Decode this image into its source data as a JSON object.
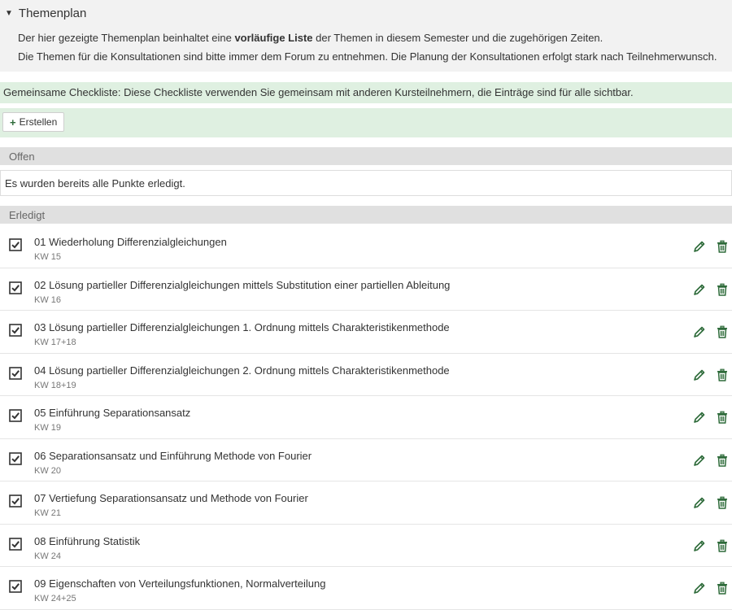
{
  "header": {
    "title": "Themenplan",
    "desc1_prefix": "Der hier gezeigte Themenplan beinhaltet eine ",
    "desc1_bold": "vorläufige Liste",
    "desc1_suffix": " der Themen in diesem Semester und die zugehörigen Zeiten.",
    "desc2": "Die Themen für die Konsultationen sind bitte immer dem Forum zu entnehmen. Die Planung der Konsultationen erfolgt stark nach Teilnehmerwunsch."
  },
  "checklist": {
    "shared_note": "Gemeinsame Checkliste: Diese Checkliste verwenden Sie gemeinsam mit anderen Kursteilnehmern, die Einträge sind für alle sichtbar.",
    "create_label": "Erstellen",
    "open_label": "Offen",
    "open_empty": "Es wurden bereits alle Punkte erledigt.",
    "done_label": "Erledigt"
  },
  "items": [
    {
      "title": "01 Wiederholung Differenzialgleichungen",
      "week": "KW 15"
    },
    {
      "title": "02 Lösung partieller Differenzialgleichungen mittels Substitution einer partiellen Ableitung",
      "week": "KW 16"
    },
    {
      "title": "03 Lösung partieller Differenzialgleichungen 1. Ordnung mittels Charakteristikenmethode",
      "week": "KW 17+18"
    },
    {
      "title": "04 Lösung partieller Differenzialgleichungen 2. Ordnung mittels Charakteristikenmethode",
      "week": "KW 18+19"
    },
    {
      "title": "05 Einführung Separationsansatz",
      "week": "KW 19"
    },
    {
      "title": "06 Separationsansatz und Einführung Methode von Fourier",
      "week": "KW 20"
    },
    {
      "title": "07 Vertiefung Separationsansatz und Methode von Fourier",
      "week": "KW 21"
    },
    {
      "title": "08 Einführung Statistik",
      "week": "KW 24"
    },
    {
      "title": "09 Eigenschaften von Verteilungsfunktionen, Normalverteilung",
      "week": "KW 24+25"
    }
  ],
  "colors": {
    "accent": "#2e6b3a",
    "info_bg": "#dff0e1",
    "section_bg": "#e0e0e0"
  },
  "icons": {
    "checkbox": "checkbox-checked-icon",
    "edit": "pencil-icon",
    "delete": "trash-icon",
    "toggle": "caret-down-icon",
    "create": "plus-icon"
  }
}
